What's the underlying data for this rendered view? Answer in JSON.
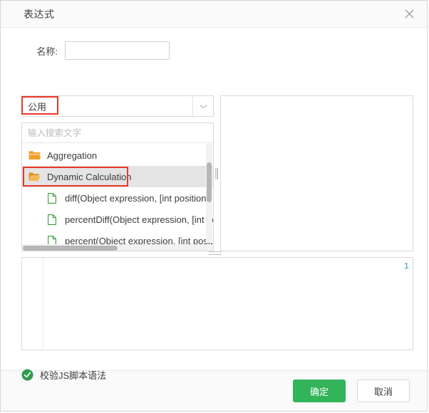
{
  "dialog": {
    "title": "表达式",
    "close_icon": "close-icon"
  },
  "form": {
    "name_label": "名称:",
    "name_value": "",
    "name_placeholder": ""
  },
  "category_select": {
    "selected": "公用",
    "arrow_icon": "chevron-down-icon"
  },
  "tree": {
    "search_placeholder": "输入搜索文字",
    "search_value": "",
    "items": [
      {
        "label": "Aggregation",
        "type": "folder",
        "icon": "folder-closed-icon",
        "selected": false
      },
      {
        "label": "Dynamic Calculation",
        "type": "folder",
        "icon": "folder-open-icon",
        "selected": true
      },
      {
        "label": "diff(Object expression, [int position])",
        "type": "leaf",
        "icon": "document-icon",
        "selected": false
      },
      {
        "label": "percentDiff(Object expression, [int position])",
        "type": "leaf",
        "icon": "document-icon",
        "selected": false
      },
      {
        "label": "percent(Object expression, [int position])",
        "type": "leaf",
        "icon": "document-icon",
        "selected": false
      }
    ]
  },
  "description_panel": {
    "content": ""
  },
  "editor": {
    "line_number": "1",
    "code": ""
  },
  "validate": {
    "label": "校验JS脚本语法",
    "icon": "check-circle-icon"
  },
  "footer": {
    "confirm_label": "确定",
    "cancel_label": "取消"
  },
  "colors": {
    "primary_green": "#33b45a",
    "annotation_red": "#e8372a",
    "folder_orange": "#f0a12c",
    "document_green": "#3a9e3a",
    "line_number_blue": "#3399cc",
    "header_bg": "#fafafa"
  }
}
